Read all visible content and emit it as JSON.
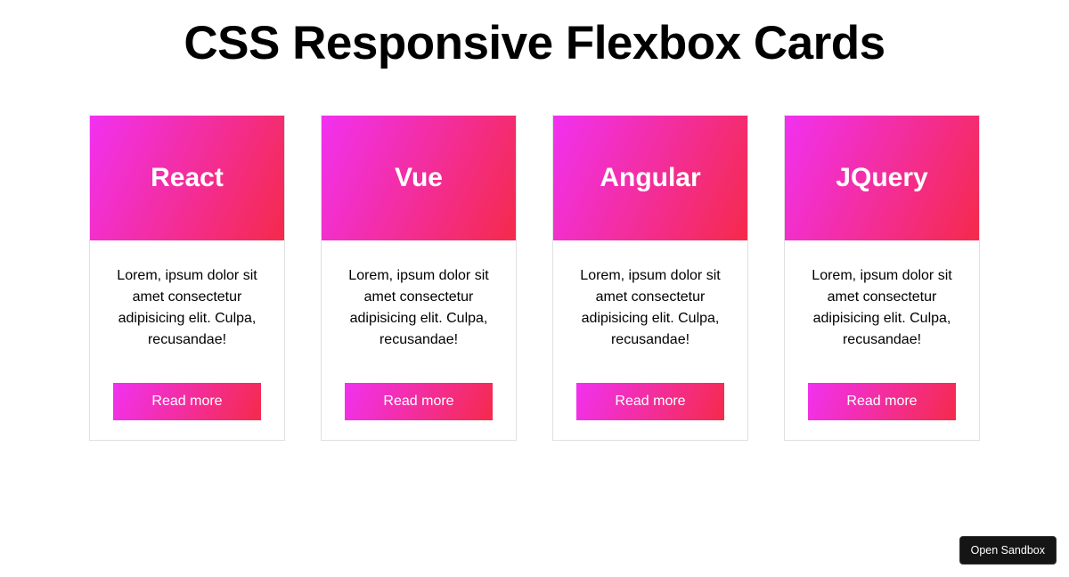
{
  "title": "CSS Responsive Flexbox Cards",
  "cards": [
    {
      "title": "React",
      "description": "Lorem, ipsum dolor sit amet consectetur adipisicing elit. Culpa, recusandae!",
      "button": "Read more"
    },
    {
      "title": "Vue",
      "description": "Lorem, ipsum dolor sit amet consectetur adipisicing elit. Culpa, recusandae!",
      "button": "Read more"
    },
    {
      "title": "Angular",
      "description": "Lorem, ipsum dolor sit amet consectetur adipisicing elit. Culpa, recusandae!",
      "button": "Read more"
    },
    {
      "title": "JQuery",
      "description": "Lorem, ipsum dolor sit amet consectetur adipisicing elit. Culpa, recusandae!",
      "button": "Read more"
    }
  ],
  "sandbox_button": "Open Sandbox"
}
